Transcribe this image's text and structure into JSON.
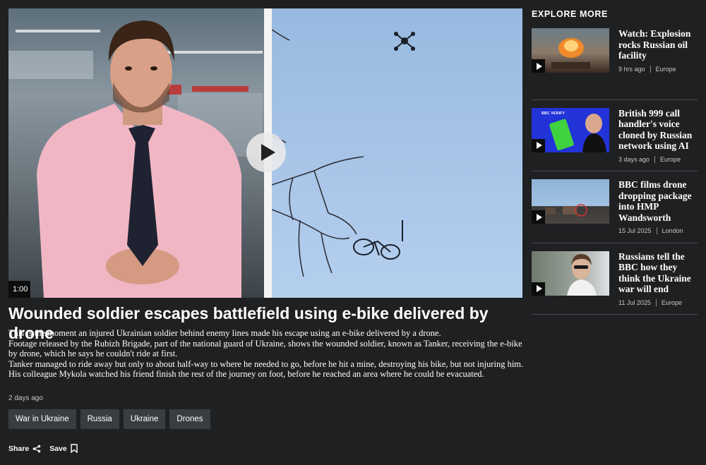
{
  "video": {
    "duration": "1:00",
    "play_label": "Play video"
  },
  "article": {
    "headline": "Wounded soldier escapes battlefield using e-bike delivered by drone",
    "paragraphs": [
      "This is the moment an injured Ukrainian soldier behind enemy lines made his escape using an e-bike delivered by a drone.",
      "Footage released by the Rubizh Brigade, part of the national guard of Ukraine, shows the wounded soldier, known as Tanker, receiving the e-bike by drone, which he says he couldn't ride at first.",
      "Tanker managed to ride away but only to about half-way to where he needed to go, before he hit a mine, destroying his bike, but not injuring him.",
      "His colleague Mykola watched his friend finish the rest of the journey on foot, before he reached an area where he could be evacuated."
    ],
    "timestamp": "2 days ago",
    "tags": [
      "War in Ukraine",
      "Russia",
      "Ukraine",
      "Drones"
    ],
    "actions": {
      "share": "Share",
      "save": "Save"
    }
  },
  "sidebar": {
    "title": "EXPLORE MORE",
    "items": [
      {
        "title": "Watch: Explosion rocks Russian oil facility",
        "time": "9 hrs ago",
        "section": "Europe"
      },
      {
        "title": "British 999 call handler's voice cloned by Russian network using AI",
        "time": "3 days ago",
        "section": "Europe",
        "thumb_badge": "BBC VERIFY"
      },
      {
        "title": "BBC films drone dropping package into HMP Wandsworth",
        "time": "15 Jul 2025",
        "section": "London"
      },
      {
        "title": "Russians tell the BBC how they think the Ukraine war will end",
        "time": "11 Jul 2025",
        "section": "Europe"
      }
    ]
  },
  "colors": {
    "background": "#1f2022",
    "tag_background": "#3a3d40",
    "text": "#ffffff",
    "muted_text": "#c8c8c8"
  }
}
